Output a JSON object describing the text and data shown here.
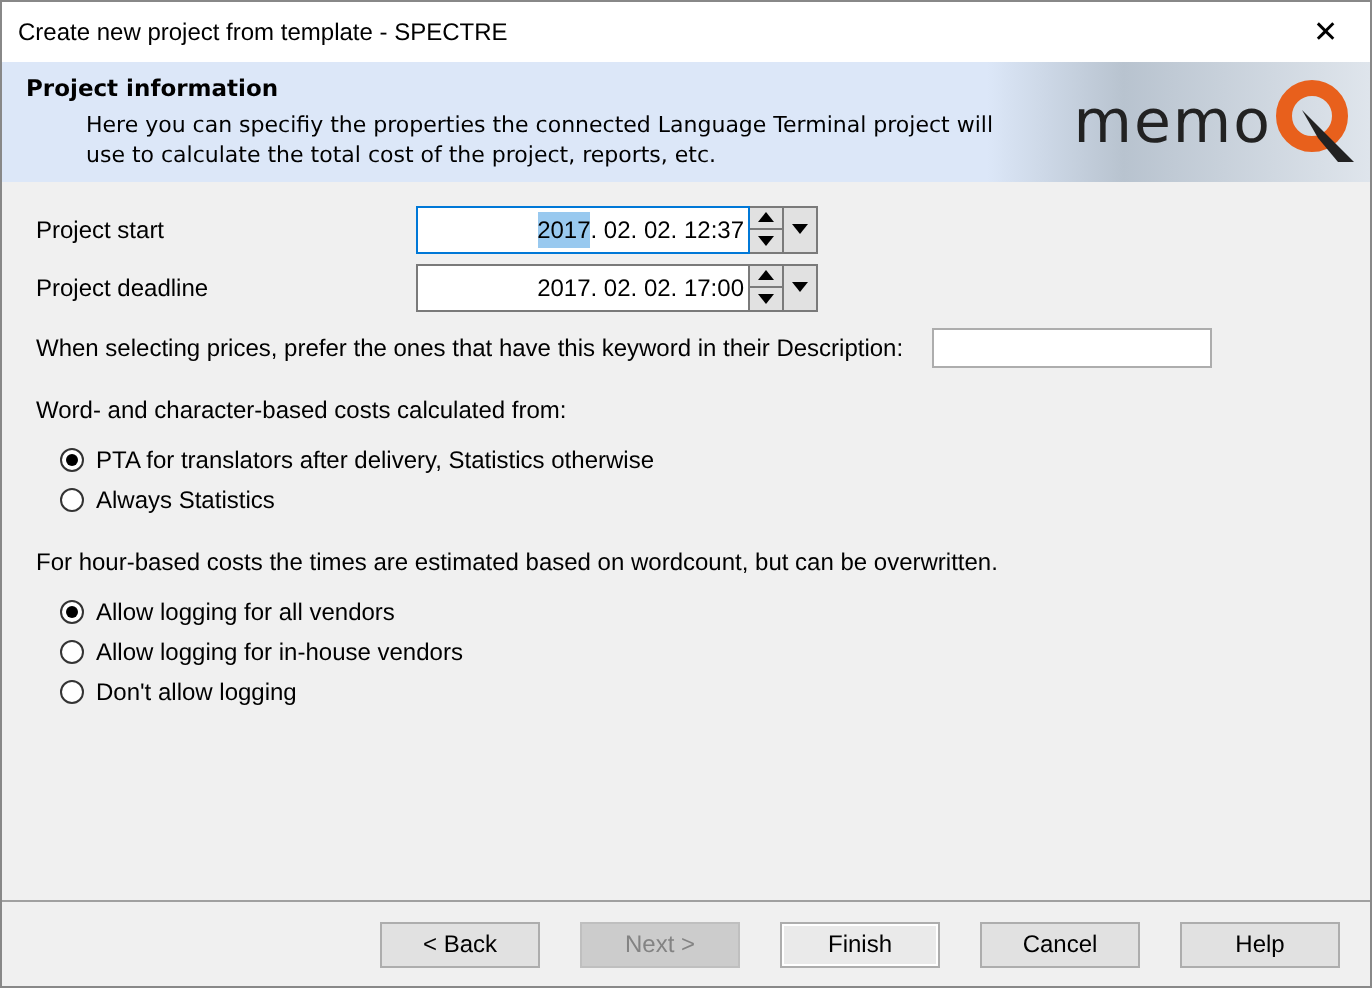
{
  "window": {
    "title": "Create new project from template - SPECTRE",
    "close": "✕"
  },
  "header": {
    "title": "Project information",
    "description": "Here you can specifiy the properties the connected Language Terminal project will use to calculate the total cost of the project, reports, etc.",
    "logo_text": "memo"
  },
  "date_fields": [
    {
      "label": "Project start",
      "selected_text": "2017",
      "text": ". 02. 02. 12:37",
      "focused": true
    },
    {
      "label": "Project deadline",
      "text": "2017. 02. 02. 17:00",
      "focused": false
    }
  ],
  "keyword": {
    "label": "When selecting prices, prefer the ones that have this keyword in their Description:"
  },
  "groups": [
    {
      "label": "Word- and character-based costs calculated from:",
      "options": [
        {
          "label": "PTA for translators after delivery, Statistics otherwise",
          "selected": true
        },
        {
          "label": "Always Statistics",
          "selected": false
        }
      ]
    },
    {
      "label": "For hour-based costs the times are estimated based on wordcount, but can be overwritten.",
      "options": [
        {
          "label": "Allow logging for all vendors",
          "selected": true
        },
        {
          "label": "Allow logging for in-house vendors",
          "selected": false
        },
        {
          "label": "Don't allow logging",
          "selected": false
        }
      ]
    }
  ],
  "buttons": [
    {
      "label": "< Back",
      "disabled": false,
      "default": false
    },
    {
      "label": "Next >",
      "disabled": true,
      "default": false
    },
    {
      "label": "Finish",
      "disabled": false,
      "default": true
    },
    {
      "label": "Cancel",
      "disabled": false,
      "default": false
    },
    {
      "label": "Help",
      "disabled": false,
      "default": false
    }
  ]
}
